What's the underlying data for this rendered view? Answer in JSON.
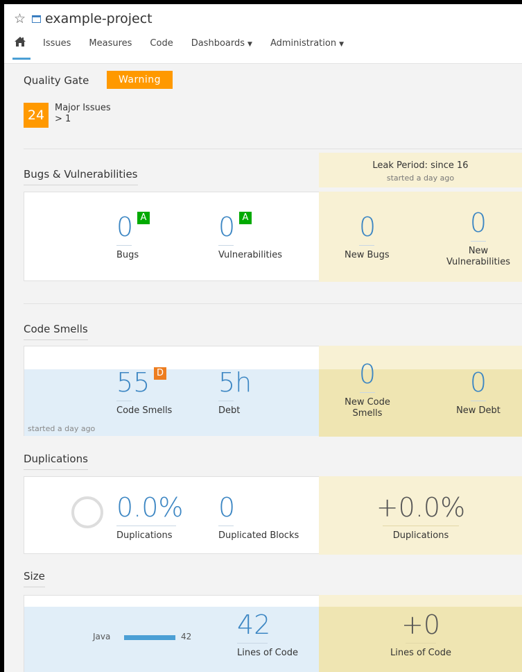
{
  "header": {
    "project_name": "example-project",
    "nav": {
      "issues": "Issues",
      "measures": "Measures",
      "code": "Code",
      "dashboards": "Dashboards",
      "administration": "Administration"
    }
  },
  "quality_gate": {
    "label": "Quality Gate",
    "status": "Warning",
    "count": "24",
    "condition_name": "Major Issues",
    "condition_value": "> 1"
  },
  "leak_period": {
    "title": "Leak Period: since 16",
    "subtitle": "started a day ago"
  },
  "bugs": {
    "title": "Bugs & Vulnerabilities",
    "bugs_value": "0",
    "bugs_label": "Bugs",
    "bugs_grade": "A",
    "vuln_value": "0",
    "vuln_label": "Vulnerabilities",
    "vuln_grade": "A",
    "new_bugs_value": "0",
    "new_bugs_label": "New Bugs",
    "new_vuln_value": "0",
    "new_vuln_label_1": "New",
    "new_vuln_label_2": "Vulnerabilities"
  },
  "code_smells": {
    "title": "Code Smells",
    "smells_value": "55",
    "smells_label": "Code Smells",
    "smells_grade": "D",
    "debt_value": "5h",
    "debt_label": "Debt",
    "new_smells_value": "0",
    "new_smells_label_1": "New Code",
    "new_smells_label_2": "Smells",
    "new_debt_value": "0",
    "new_debt_label": "New Debt",
    "history_note": "started a day ago"
  },
  "duplications": {
    "title": "Duplications",
    "dup_value": "0.0%",
    "dup_label": "Duplications",
    "blocks_value": "0",
    "blocks_label": "Duplicated Blocks",
    "new_dup_value": "+0.0%",
    "new_dup_label": "Duplications"
  },
  "size": {
    "title": "Size",
    "language": "Java",
    "language_loc": "42",
    "language_share": 1.0,
    "loc_value": "42",
    "loc_label": "Lines of Code",
    "new_loc_value": "+0",
    "new_loc_label": "Lines of Code"
  },
  "colors": {
    "warning": "#ff9900",
    "grade_a": "#00aa00",
    "grade_d": "#ed7d20",
    "measure_blue": "#3c86c3",
    "leak_bg": "#f8f1d4",
    "leak_bg_dark": "#efe5b2"
  }
}
